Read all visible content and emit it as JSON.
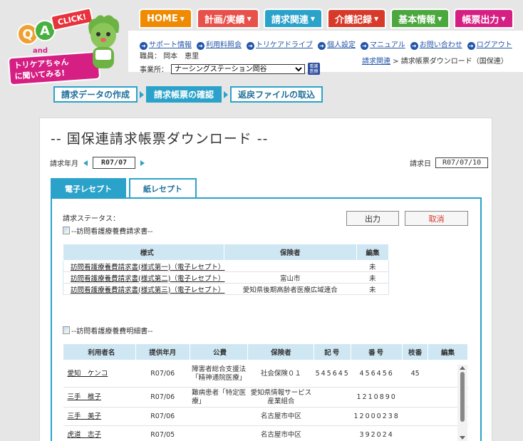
{
  "logo": {
    "q": "Q",
    "a": "A",
    "click": "CLICK!",
    "and": "and",
    "text_line1": "トリケアちゃん",
    "text_line2": "に聞いてみる!"
  },
  "nav": [
    {
      "label": "HOME",
      "color": "#f08a00"
    },
    {
      "label": "計画/実績",
      "color": "#e8504a"
    },
    {
      "label": "請求関連",
      "color": "#2aa2c9"
    },
    {
      "label": "介護記録",
      "color": "#d83a2a"
    },
    {
      "label": "基本情報",
      "color": "#4aa83e"
    },
    {
      "label": "帳票出力",
      "color": "#d61f83"
    }
  ],
  "nav_arrow": "▼",
  "links": [
    "サポート情報",
    "利用料照会",
    "トリケアドライブ",
    "個人設定",
    "マニュアル",
    "お問い合わせ",
    "ログアウト"
  ],
  "staff": {
    "label": "職員：",
    "name": "岡本　恵里"
  },
  "office": {
    "label": "事業所：",
    "selected": "ナーシングステーション岡谷",
    "icon_text1": "看護",
    "icon_text2": "医療"
  },
  "breadcrumb": {
    "link": "請求関連",
    "sep": " > ",
    "current": "請求帳票ダウンロード（国保連）"
  },
  "steps": [
    "請求データの作成",
    "請求帳票の確認",
    "返戻ファイルの取込"
  ],
  "page_title": "-- 国保連請求帳票ダウンロード --",
  "period": {
    "label": "請求年月",
    "value": "R07/07"
  },
  "claim_date": {
    "label": "請求日",
    "value": "R07/07/10"
  },
  "tabs": [
    "電子レセプト",
    "紙レセプト"
  ],
  "status_label": "請求ステータス：",
  "buttons": {
    "output": "出力",
    "cancel": "取消"
  },
  "section1_alt": "--訪問看護療養費請求書--",
  "table1": {
    "headers": [
      "様式",
      "保険者",
      "編集"
    ],
    "rows": [
      [
        "訪問看護療養費請求書(様式第一)（電子レセプト）",
        "",
        "未"
      ],
      [
        "訪問看護療養費請求書(様式第二)（電子レセプト）",
        "富山市",
        "未"
      ],
      [
        "訪問看護療養費請求書(様式第三)（電子レセプト）",
        "愛知県後期高齢者医療広域連合",
        "未"
      ]
    ]
  },
  "section2_alt": "--訪問看護療養費明細書--",
  "table2": {
    "headers": [
      "利用者名",
      "提供年月",
      "公費",
      "保険者",
      "記号",
      "番号",
      "枝番",
      "編集"
    ],
    "rows": [
      [
        "愛知　ケンコ",
        "R07/06",
        "障害者総合支援法「精神通院医療」",
        "社会保険０１",
        "545645",
        "456456",
        "45",
        ""
      ],
      [
        "三手　椎子",
        "R07/06",
        "難病患者「特定医療」",
        "愛知県情報サービス産業組合",
        "",
        "1210890",
        "",
        ""
      ],
      [
        "三手　美子",
        "R07/06",
        "",
        "名古屋市中区",
        "",
        "12000238",
        "",
        ""
      ],
      [
        "虎道　志子",
        "R07/05",
        "",
        "名古屋市中区",
        "",
        "392024",
        "",
        ""
      ]
    ]
  }
}
